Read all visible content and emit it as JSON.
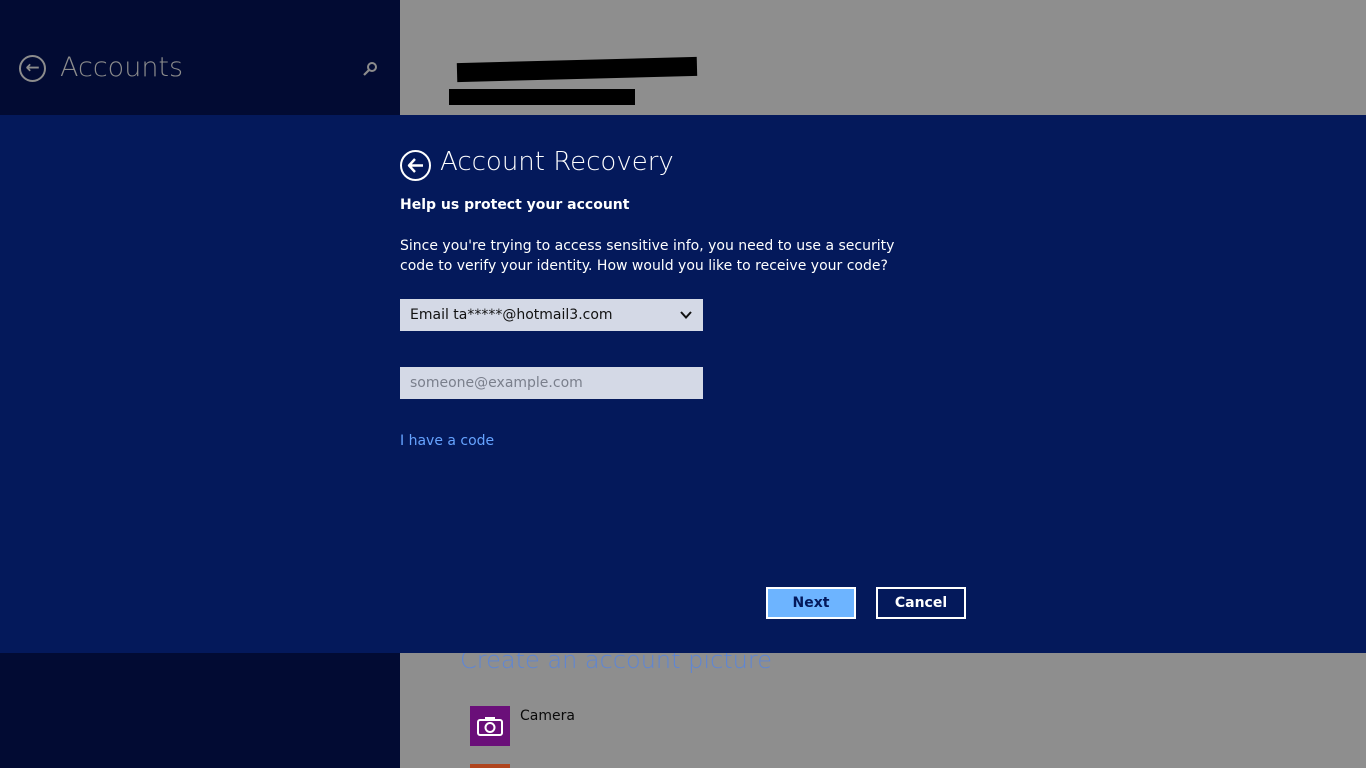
{
  "background": {
    "header": {
      "title": "Accounts"
    },
    "section_title": "Create an account picture",
    "picture_options": [
      {
        "label": "Camera",
        "icon": "camera-icon",
        "color": "#6a0f79"
      }
    ]
  },
  "dialog": {
    "title": "Account Recovery",
    "subtitle": "Help us protect your account",
    "description": "Since you're trying to access sensitive info, you need to use a security code to verify your identity. How would you like to receive your code?",
    "method_select": {
      "value": "Email ta*****@hotmail3.com"
    },
    "email_input": {
      "value": "",
      "placeholder": "someone@example.com"
    },
    "have_code_link": "I have a code",
    "next_label": "Next",
    "cancel_label": "Cancel"
  },
  "colors": {
    "dialog_bg": "#04195b",
    "left_pane_bg": "#020b33",
    "accent_link": "#66a3ff",
    "next_button": "#6db4ff"
  }
}
